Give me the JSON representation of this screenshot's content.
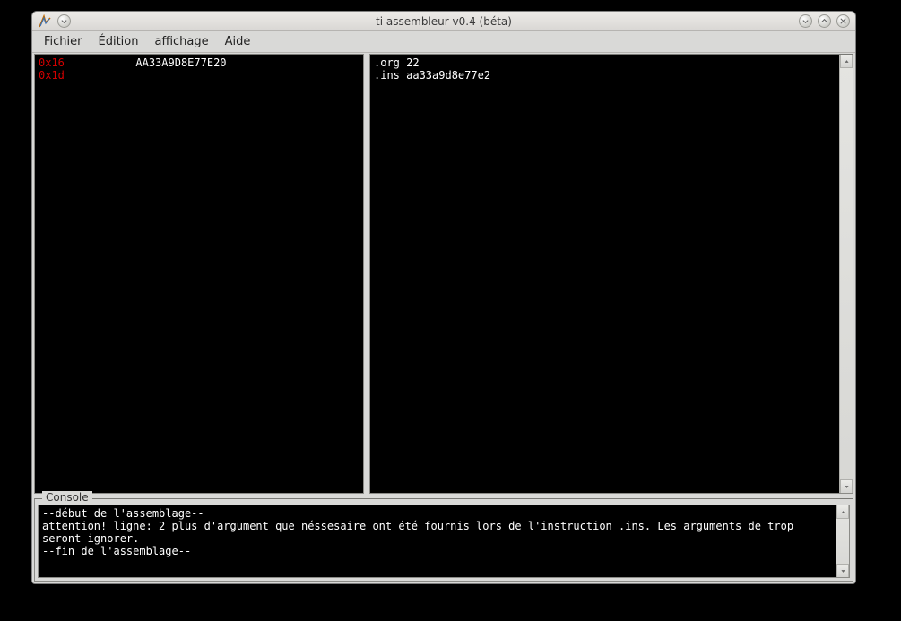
{
  "window": {
    "title": "ti assembleur v0.4 (béta)"
  },
  "menu": {
    "file": "Fichier",
    "edit": "Édition",
    "view": "affichage",
    "help": "Aide"
  },
  "left_pane": {
    "lines": [
      {
        "addr": "0x16",
        "bytes": "AA33A9D8E77E20"
      },
      {
        "addr": "0x1d",
        "bytes": ""
      }
    ]
  },
  "right_pane": {
    "source": ".org 22\n.ins aa33a9d8e77e2"
  },
  "console": {
    "label": "Console",
    "text": "--début de l'assemblage--\nattention! ligne: 2 plus d'argument que néssesaire ont été fournis lors de l'instruction .ins. Les arguments de trop seront ignorer.\n--fin de l'assemblage--"
  }
}
